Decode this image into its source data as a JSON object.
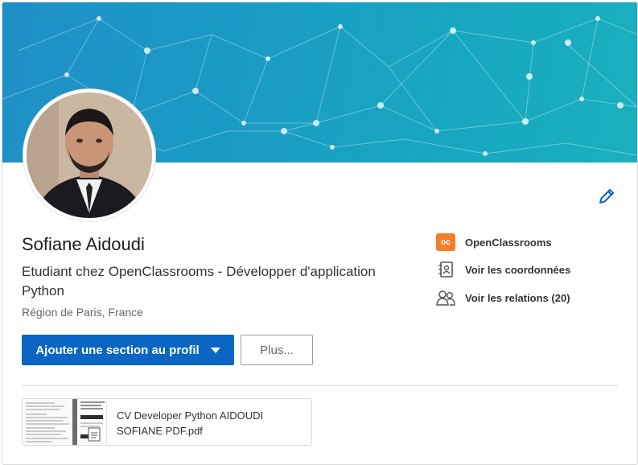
{
  "profile": {
    "name": "Sofiane Aidoudi",
    "headline": "Etudiant chez OpenClassrooms - Développer d'application Python",
    "location": "Région de Paris, France"
  },
  "actions": {
    "add_section_label": "Ajouter une section au profil",
    "more_label": "Plus..."
  },
  "sidebar": {
    "company_logo_text": "oc",
    "company": "OpenClassrooms",
    "contact_info": "Voir les coordonnées",
    "connections": "Voir les relations (20)"
  },
  "document": {
    "title": "CV Developer Python AIDOUDI SOFIANE PDF.pdf"
  },
  "colors": {
    "banner_start": "#1f8fc7",
    "banner_end": "#1ab0bd",
    "primary_button": "#0a66c2",
    "edit_icon": "#0a66c2",
    "company_logo": "#f47c2a"
  }
}
